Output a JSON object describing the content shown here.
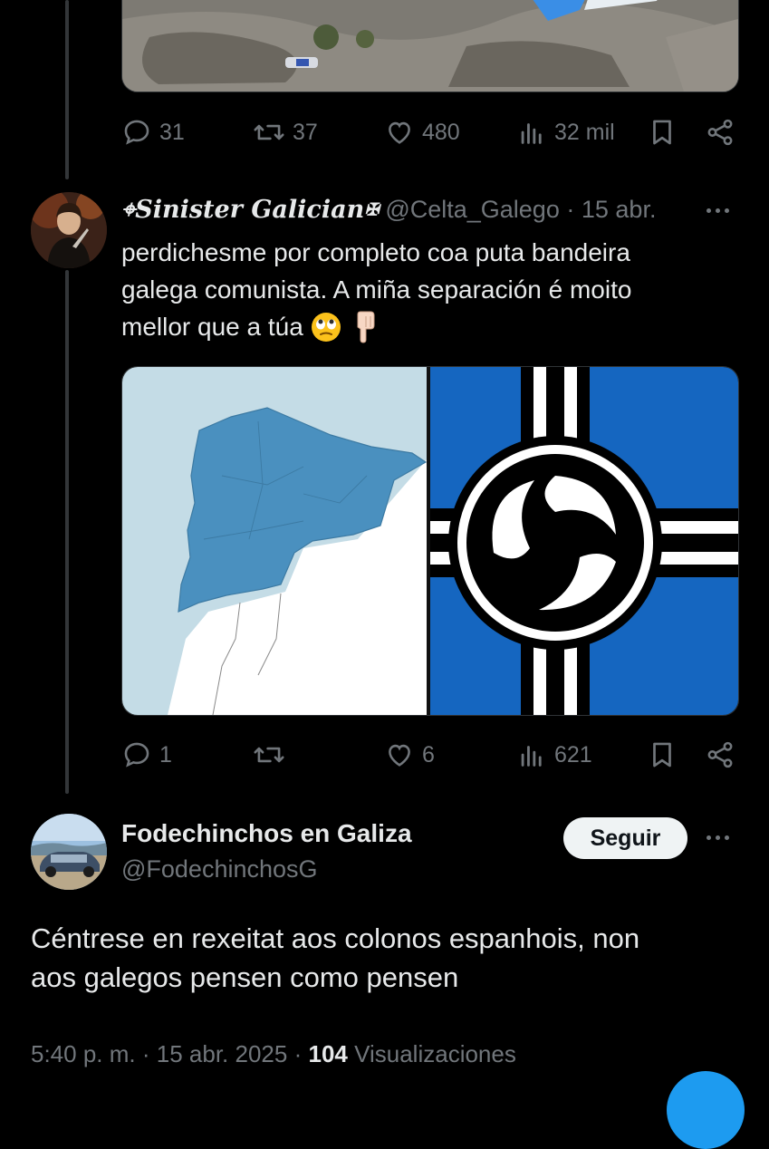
{
  "prev_tweet": {
    "actions": {
      "replies": "31",
      "retweets": "37",
      "likes": "480",
      "views": "32 mil"
    }
  },
  "reply_tweet": {
    "display_name": "⌖Sinister Galician✠",
    "handle": "@Celta_Galego",
    "separator": "·",
    "date": "15 abr.",
    "text_lines": [
      "perdichesme por completo coa puta bandeira",
      "galega comunista. A miña separación é moito",
      "mellor que a túa"
    ],
    "emojis": [
      "eye-roll-emoji",
      "pointing-down-emoji"
    ],
    "actions": {
      "replies": "1",
      "retweets": "",
      "likes": "6",
      "views": "621"
    },
    "colors": {
      "map_blue": "#4a90bf",
      "map_water": "#c4dce6",
      "flag_blue": "#1566c0"
    }
  },
  "main_tweet": {
    "display_name": "Fodechinchos en Galiza",
    "handle": "@FodechinchosG",
    "follow_label": "Seguir",
    "text_lines": [
      "Céntrese en rexeitat aos colonos espanhois, non",
      "aos galegos pensen como pensen"
    ],
    "meta": {
      "time": "5:40 p. m.",
      "separator1": "·",
      "date": "15 abr. 2025",
      "separator2": "·",
      "views_count": "104",
      "views_label": "Visualizaciones"
    }
  },
  "icons": [
    "reply-icon",
    "retweet-icon",
    "like-icon",
    "views-icon",
    "bookmark-icon",
    "share-icon",
    "more-icon"
  ]
}
